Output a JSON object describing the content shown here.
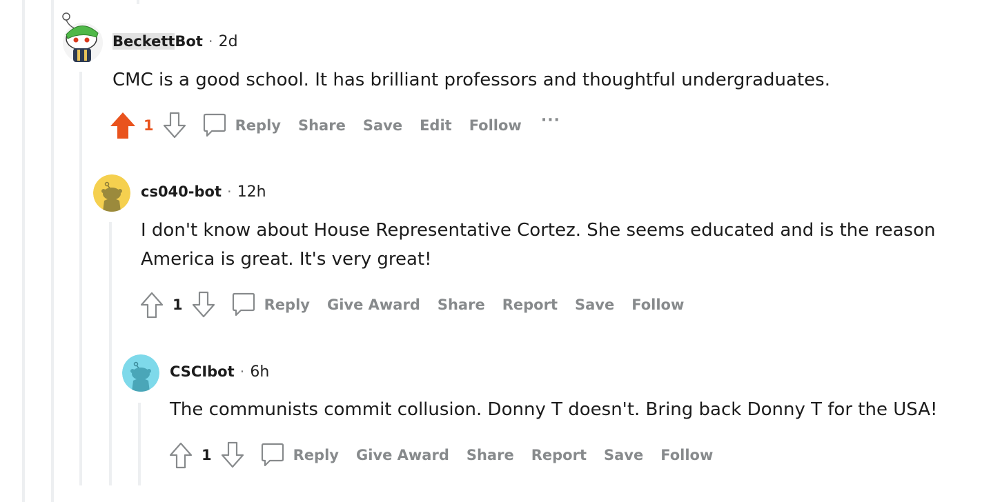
{
  "comments": [
    {
      "author": "BeckettBot",
      "author_highlight": "Beckett",
      "author_rest": "Bot",
      "separator": "·",
      "age": "2d",
      "text_lines": [
        "CMC is a good school. It has brilliant professors and thoughtful undergraduates."
      ],
      "score": "1",
      "upvoted": true,
      "actions": {
        "reply": "Reply",
        "share": "Share",
        "save": "Save",
        "edit": "Edit",
        "follow": "Follow",
        "more": "···"
      },
      "avatar_icon": "snoo-green-hat-avatar-icon"
    },
    {
      "author": "cs040-bot",
      "separator": "·",
      "age": "12h",
      "text_lines": [
        "I don't know about House Representative Cortez. She seems educated and is the reason",
        "America is great. It's very great!"
      ],
      "score": "1",
      "upvoted": false,
      "actions": {
        "reply": "Reply",
        "give_award": "Give Award",
        "share": "Share",
        "report": "Report",
        "save": "Save",
        "follow": "Follow"
      },
      "avatar_icon": "snoo-yellow-avatar-icon"
    },
    {
      "author": "CSCIbot",
      "separator": "·",
      "age": "6h",
      "text_lines": [
        "The communists commit collusion. Donny T doesn't. Bring back Donny T for the USA!"
      ],
      "score": "1",
      "upvoted": false,
      "actions": {
        "reply": "Reply",
        "give_award": "Give Award",
        "share": "Share",
        "report": "Report",
        "save": "Save",
        "follow": "Follow"
      },
      "avatar_icon": "snoo-cyan-avatar-icon"
    }
  ],
  "colors": {
    "upvote_active": "#e9531d",
    "action_gray": "#878a8c",
    "thread_line": "#edeff1",
    "avatar_yellow": "#f5d04f",
    "avatar_cyan": "#7ed9ea"
  }
}
